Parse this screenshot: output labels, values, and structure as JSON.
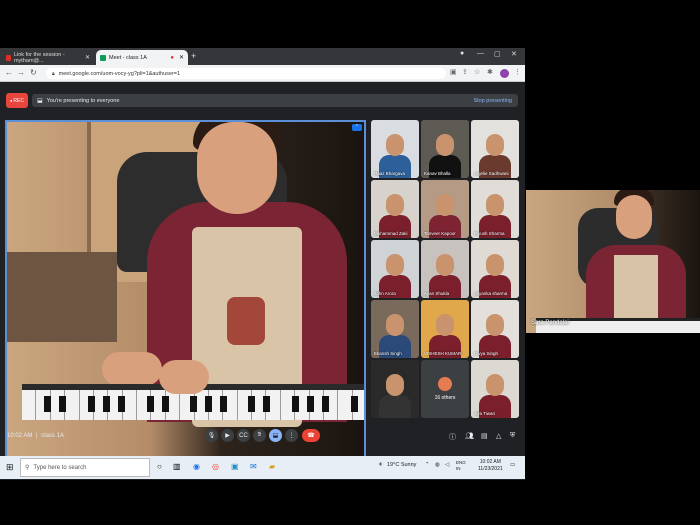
{
  "browser": {
    "tabs": [
      {
        "label": "Link for the session - mytham@...",
        "active": false,
        "favicon_color": "#d93025"
      },
      {
        "label": "Meet - class 1A",
        "active": true,
        "favicon_color": "#0f9d58"
      }
    ],
    "url": "meet.google.com/uom-vocy-yg?pli=1&authuser=1"
  },
  "meet": {
    "rec_label": "REC",
    "presenting_text": "You're presenting to everyone",
    "stop_presenting": "Stop presenting",
    "meeting_time": "10:02 AM",
    "meeting_name": "class 1A",
    "pin_label": "⌃",
    "participants": [
      {
        "name": "Raaz Bhargava",
        "shirt": "#2d5f9a",
        "bg": "#d9dce0"
      },
      {
        "name": "Kanav Bhalla",
        "shirt": "#111111",
        "bg": "#5e5a54"
      },
      {
        "name": "Anjelie Sadhwani",
        "shirt": "#6b3a2f",
        "bg": "#e3e1de"
      },
      {
        "name": "Muhammad Zaki",
        "shirt": "#7a1f2b",
        "bg": "#d7d2cc"
      },
      {
        "name": "Tanveer Kapoor",
        "shirt": "#7d2332",
        "bg": "#b59a86"
      },
      {
        "name": "Piyush Sharma",
        "shirt": "#7a1f2b",
        "bg": "#e0ddd8"
      },
      {
        "name": "John Arora",
        "shirt": "#7a1f2b",
        "bg": "#cfd3d6"
      },
      {
        "name": "Ayan Shukla",
        "shirt": "#7a1f2b",
        "bg": "#c7c2bd"
      },
      {
        "name": "priyanka sharma",
        "shirt": "#7a1f2b",
        "bg": "#dfdad4"
      },
      {
        "name": "Ekansh Singh",
        "shirt": "#2b4a7a",
        "bg": "#7a6a5c"
      },
      {
        "name": "VISHESH KUMAR",
        "shirt": "#7a1f2b",
        "bg": "#e0a84a"
      },
      {
        "name": "Divya Singh",
        "shirt": "#7a1f2b",
        "bg": "#e3e0dc"
      },
      {
        "name": "",
        "shirt": "#333333",
        "bg": "#2a2a2a"
      },
      {
        "name": "",
        "shirt": "#3c4043",
        "bg": "#3c4043"
      },
      {
        "name": "Jiya Tiwari",
        "shirt": "#7a1f2b",
        "bg": "#dcd8d2"
      }
    ],
    "others_label": "16 others"
  },
  "taskbar": {
    "search_placeholder": "Type here to search",
    "weather": "19°C Sunny",
    "lang": "ENG",
    "region": "IN",
    "time": "10:02 AM",
    "date": "11/23/2021"
  },
  "side_view": {
    "name": "Sara Pandalai"
  }
}
